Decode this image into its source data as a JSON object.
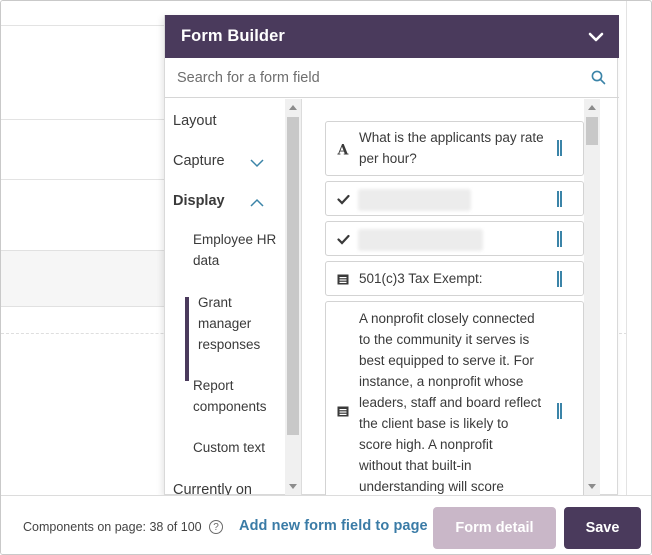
{
  "form_builder": {
    "title": "Form Builder",
    "collapse_icon": "chevron-down-icon",
    "search": {
      "placeholder": "Search for a form field",
      "value": ""
    }
  },
  "nav": {
    "layout": "Layout",
    "capture": "Capture",
    "display": "Display",
    "display_items": [
      [
        "Employee HR",
        "data"
      ],
      [
        "Grant",
        "manager",
        "responses"
      ],
      [
        "Report",
        "components"
      ],
      [
        "Custom text"
      ]
    ],
    "currently_on": "Currently on"
  },
  "fields": [
    {
      "icon": "text-a-icon",
      "lines": [
        "What is the applicants pay rate",
        "per hour?"
      ]
    },
    {
      "icon": "checkmark-icon",
      "lines": []
    },
    {
      "icon": "checkmark-icon",
      "lines": []
    },
    {
      "icon": "table-icon",
      "lines": [
        "501(c)3 Tax Exempt:"
      ]
    },
    {
      "icon": "table-icon",
      "lines": [
        "A nonprofit closely connected",
        "to the community it serves is",
        "best equipped to serve it. For",
        "instance, a nonprofit whose",
        "leaders, staff and board reflect",
        "the client base is likely to",
        "score high. A nonprofit",
        "without that built-in",
        "understanding will score"
      ]
    }
  ],
  "footer": {
    "count_label": "Components on page: 38 of 100",
    "help_glyph": "?",
    "add_link": "Add new form field to page",
    "detail_button": "Form detail",
    "save_button": "Save"
  },
  "colors": {
    "brand_purple": "#4a3a5c",
    "link_blue": "#3a7ba6",
    "disabled_button": "#c9b7c8"
  }
}
